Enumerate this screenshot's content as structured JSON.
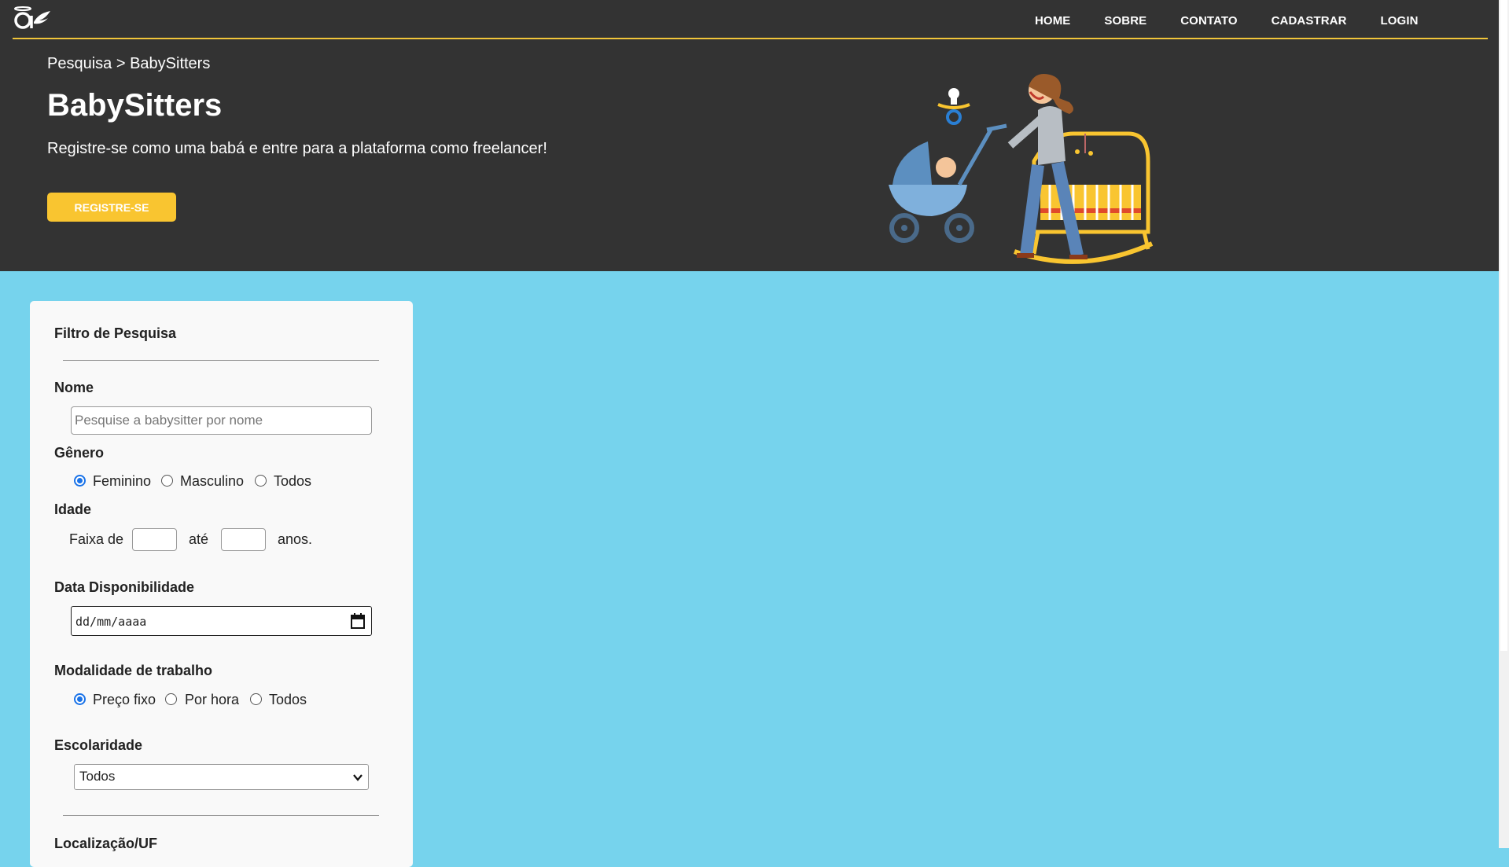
{
  "header": {
    "nav": [
      "HOME",
      "SOBRE",
      "CONTATO",
      "CADASTRAR",
      "LOGIN"
    ],
    "breadcrumb": "Pesquisa > BabySitters",
    "title": "BabySitters",
    "subtitle": "Registre-se como uma babá e entre para a plataforma como freelancer!",
    "cta_label": "REGISTRE-SE",
    "accent_color": "#f9c530",
    "hero_bg": "#333333",
    "page_bg": "#76d3ed"
  },
  "filter": {
    "title": "Filtro de Pesquisa",
    "name_label": "Nome",
    "name_placeholder": "Pesquise a babysitter por nome",
    "gender_label": "Gênero",
    "gender_options": [
      "Feminino",
      "Masculino",
      "Todos"
    ],
    "gender_selected": "Feminino",
    "age_label": "Idade",
    "age_prefix": "Faixa de",
    "age_mid": "até",
    "age_suffix": "anos.",
    "date_label": "Data Disponibilidade",
    "date_placeholder": "dd/mm/aaaa",
    "work_label": "Modalidade de trabalho",
    "work_options": [
      "Preço fixo",
      "Por hora",
      "Todos"
    ],
    "work_selected": "Preço fixo",
    "education_label": "Escolaridade",
    "education_value": "Todos",
    "location_label": "Localização/UF"
  }
}
